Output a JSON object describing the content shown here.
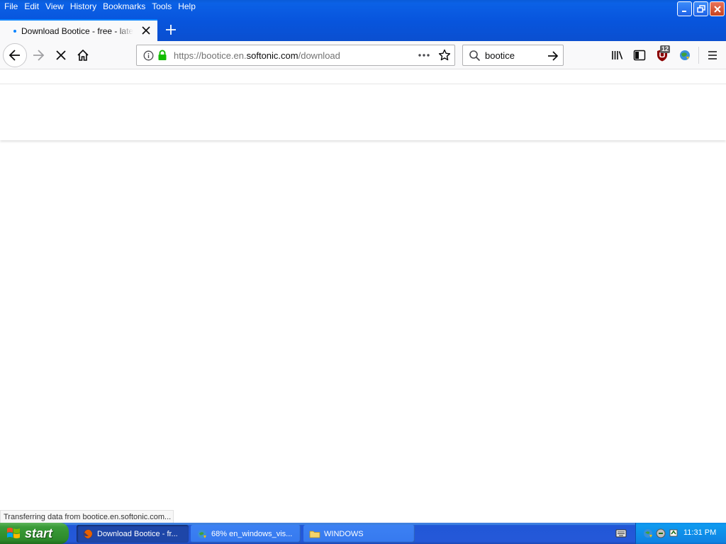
{
  "menubar": {
    "items": [
      "File",
      "Edit",
      "View",
      "History",
      "Bookmarks",
      "Tools",
      "Help"
    ]
  },
  "tab": {
    "title": "Download Bootice - free - latest version"
  },
  "urlbar": {
    "url_prefix": "https://bootice.en.",
    "url_host": "softonic.com",
    "url_path": "/download"
  },
  "searchbar": {
    "value": "bootice"
  },
  "toolbar": {
    "ublock_badge": "12"
  },
  "status": {
    "text": "Transferring data from bootice.en.softonic.com..."
  },
  "taskbar": {
    "start_label": "start",
    "tasks": [
      {
        "label": "Download Bootice - fr...",
        "active": true
      },
      {
        "label": "68% en_windows_vis...",
        "active": false
      },
      {
        "label": "WINDOWS",
        "active": false
      }
    ],
    "clock": "11:31 PM"
  },
  "colors": {
    "accent": "#0a84ff",
    "xp_blue": "#0855dd",
    "lock_green": "#12bc00",
    "start_green": "#3a9b38"
  }
}
